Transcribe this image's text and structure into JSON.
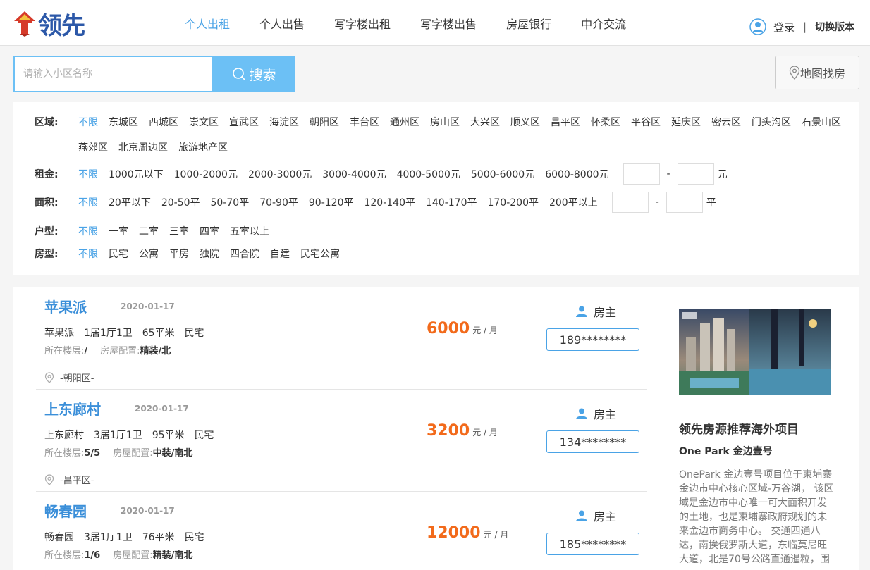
{
  "header": {
    "logo_text": "领先",
    "nav": [
      "个人出租",
      "个人出售",
      "写字楼出租",
      "写字楼出售",
      "房屋银行",
      "中介交流"
    ],
    "active_nav": 0,
    "login": "登录",
    "separator": "|",
    "switch_version": "切换版本"
  },
  "search": {
    "placeholder": "请输入小区名称",
    "button": "搜索",
    "map_button": "地图找房"
  },
  "filters": {
    "district": {
      "label": "区域:",
      "options": [
        "不限",
        "东城区",
        "西城区",
        "崇文区",
        "宣武区",
        "海淀区",
        "朝阳区",
        "丰台区",
        "通州区",
        "房山区",
        "大兴区",
        "顺义区",
        "昌平区",
        "怀柔区",
        "平谷区",
        "延庆区",
        "密云区",
        "门头沟区",
        "石景山区",
        "燕郊区",
        "北京周边区",
        "旅游地产区"
      ]
    },
    "rent": {
      "label": "租金:",
      "options": [
        "不限",
        "1000元以下",
        "1000-2000元",
        "2000-3000元",
        "3000-4000元",
        "4000-5000元",
        "5000-6000元",
        "6000-8000元"
      ],
      "range_sep": "-",
      "unit": "元"
    },
    "area": {
      "label": "面积:",
      "options": [
        "不限",
        "20平以下",
        "20-50平",
        "50-70平",
        "70-90平",
        "90-120平",
        "120-140平",
        "140-170平",
        "170-200平",
        "200平以上"
      ],
      "range_sep": "-",
      "unit": "平"
    },
    "layout": {
      "label": "户型:",
      "options": [
        "不限",
        "一室",
        "二室",
        "三室",
        "四室",
        "五室以上"
      ]
    },
    "house_type": {
      "label": "房型:",
      "options": [
        "不限",
        "民宅",
        "公寓",
        "平房",
        "独院",
        "四合院",
        "自建",
        "民宅公寓"
      ]
    }
  },
  "listings": [
    {
      "title": "苹果派",
      "date": "2020-01-17",
      "name": "苹果派",
      "rooms": "1居1厅1卫",
      "size": "65平米",
      "type": "民宅",
      "floor_label": "所在楼层:",
      "floor": "/",
      "config_label": "房屋配置:",
      "config": "精装/北",
      "location": "-朝阳区-",
      "price": "6000",
      "price_unit": "元 / 月",
      "owner": "房主",
      "phone": "189********"
    },
    {
      "title": "上东廊村",
      "date": "2020-01-17",
      "name": "上东廊村",
      "rooms": "3居1厅1卫",
      "size": "95平米",
      "type": "民宅",
      "floor_label": "所在楼层:",
      "floor": "5/5",
      "config_label": "房屋配置:",
      "config": "中装/南北",
      "location": "-昌平区-",
      "price": "3200",
      "price_unit": "元 / 月",
      "owner": "房主",
      "phone": "134********"
    },
    {
      "title": "畅春园",
      "date": "2020-01-17",
      "name": "畅春园",
      "rooms": "3居1厅1卫",
      "size": "76平米",
      "type": "民宅",
      "floor_label": "所在楼层:",
      "floor": "1/6",
      "config_label": "房屋配置:",
      "config": "精装/南北",
      "location": "",
      "price": "12000",
      "price_unit": "元 / 月",
      "owner": "房主",
      "phone": "185********"
    }
  ],
  "promo": {
    "title": "领先房源推荐海外项目",
    "subtitle": "One Park 金边壹号",
    "description": "OnePark 金边壹号项目位于柬埔寨金边市中心核心区域-万谷湖， 该区域是金边市中心唯一可大面积开发的土地，也是柬埔寨政府规划的未来金边市商务中心。 交通四通八达，南挨俄罗斯大道，东临莫尼旺大道，北是70号公路直通暹粒，围"
  },
  "colors": {
    "accent": "#4aa3e6",
    "title_blue": "#3b8fd9",
    "price": "#f26a1b",
    "search": "#6cc0f5"
  }
}
